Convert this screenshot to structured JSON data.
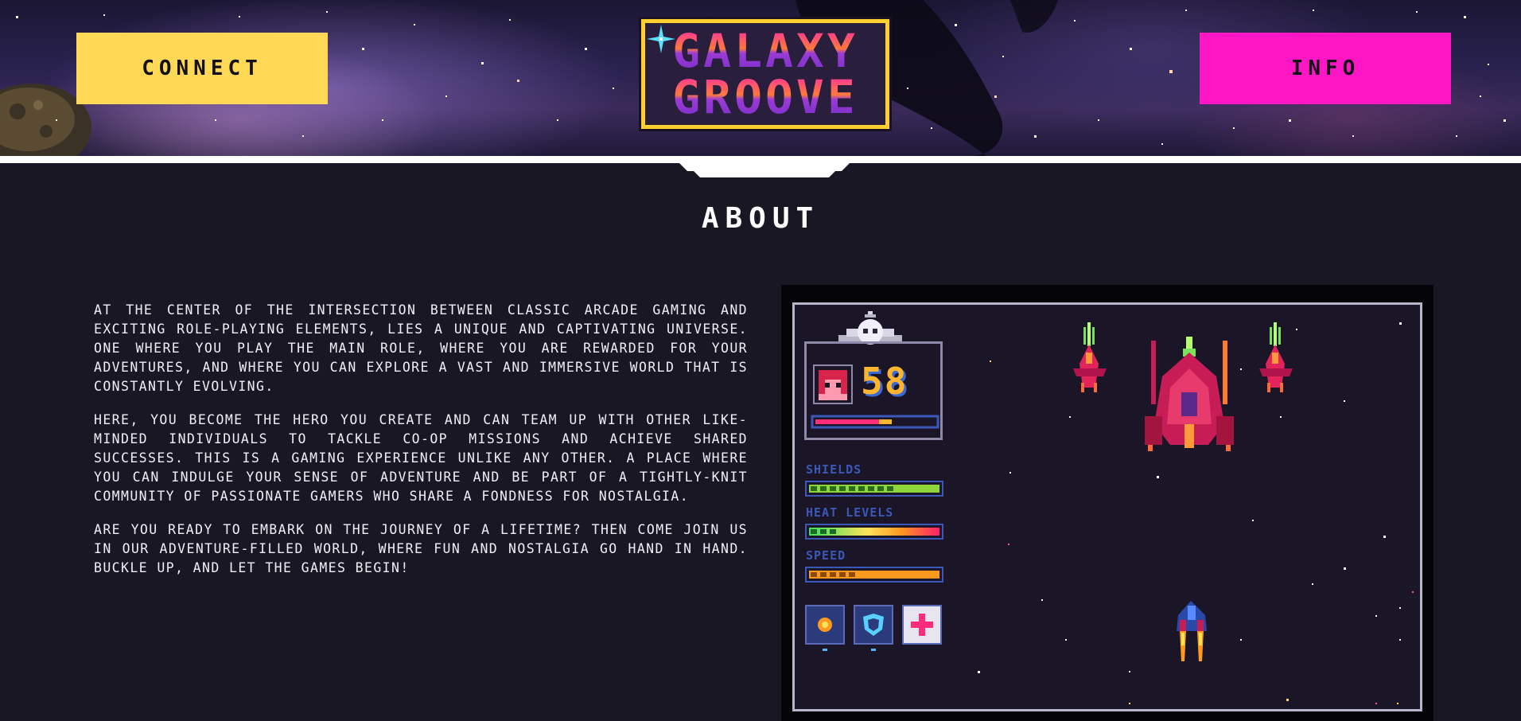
{
  "header": {
    "connect_label": "CONNECT",
    "info_label": "INFO",
    "logo": {
      "line1": "GALAXY",
      "line2": "GROOVE"
    }
  },
  "about": {
    "title": "ABOUT",
    "paragraphs": [
      "At the center of the intersection between classic arcade gaming and exciting role-playing elements, lies a unique and captivating universe. One where you play the main role, where you are rewarded for your adventures, and where you can explore a vast and immersive world that is constantly evolving.",
      "Here, you become the hero you create and can team up with other like-minded individuals to tackle co-op missions and achieve shared successes. This is a gaming experience unlike any other. A place where you can indulge your sense of adventure and be part of a tightly-knit community of passionate gamers who share a fondness for nostalgia.",
      "Are you ready to embark on the journey of a lifetime? Then come join us in our adventure-filled world, where fun and nostalgia go hand in hand. Buckle up, and let the games begin!"
    ]
  },
  "game": {
    "player_level": "58",
    "stats": [
      {
        "label": "SHIELDS",
        "level": 0.72,
        "color": "#8fd63a"
      },
      {
        "label": "HEAT LEVELS",
        "level": 0.95,
        "color": "#ff2d78"
      },
      {
        "label": "SPEED",
        "level": 1.0,
        "color": "#ff9a1f"
      }
    ],
    "power_ups": [
      "fire-orb-icon",
      "shield-icon",
      "health-plus-icon"
    ]
  },
  "colors": {
    "background": "#1a1724",
    "connect": "#ffd955",
    "info": "#ff17c5",
    "logo_border": "#ffce2f"
  }
}
